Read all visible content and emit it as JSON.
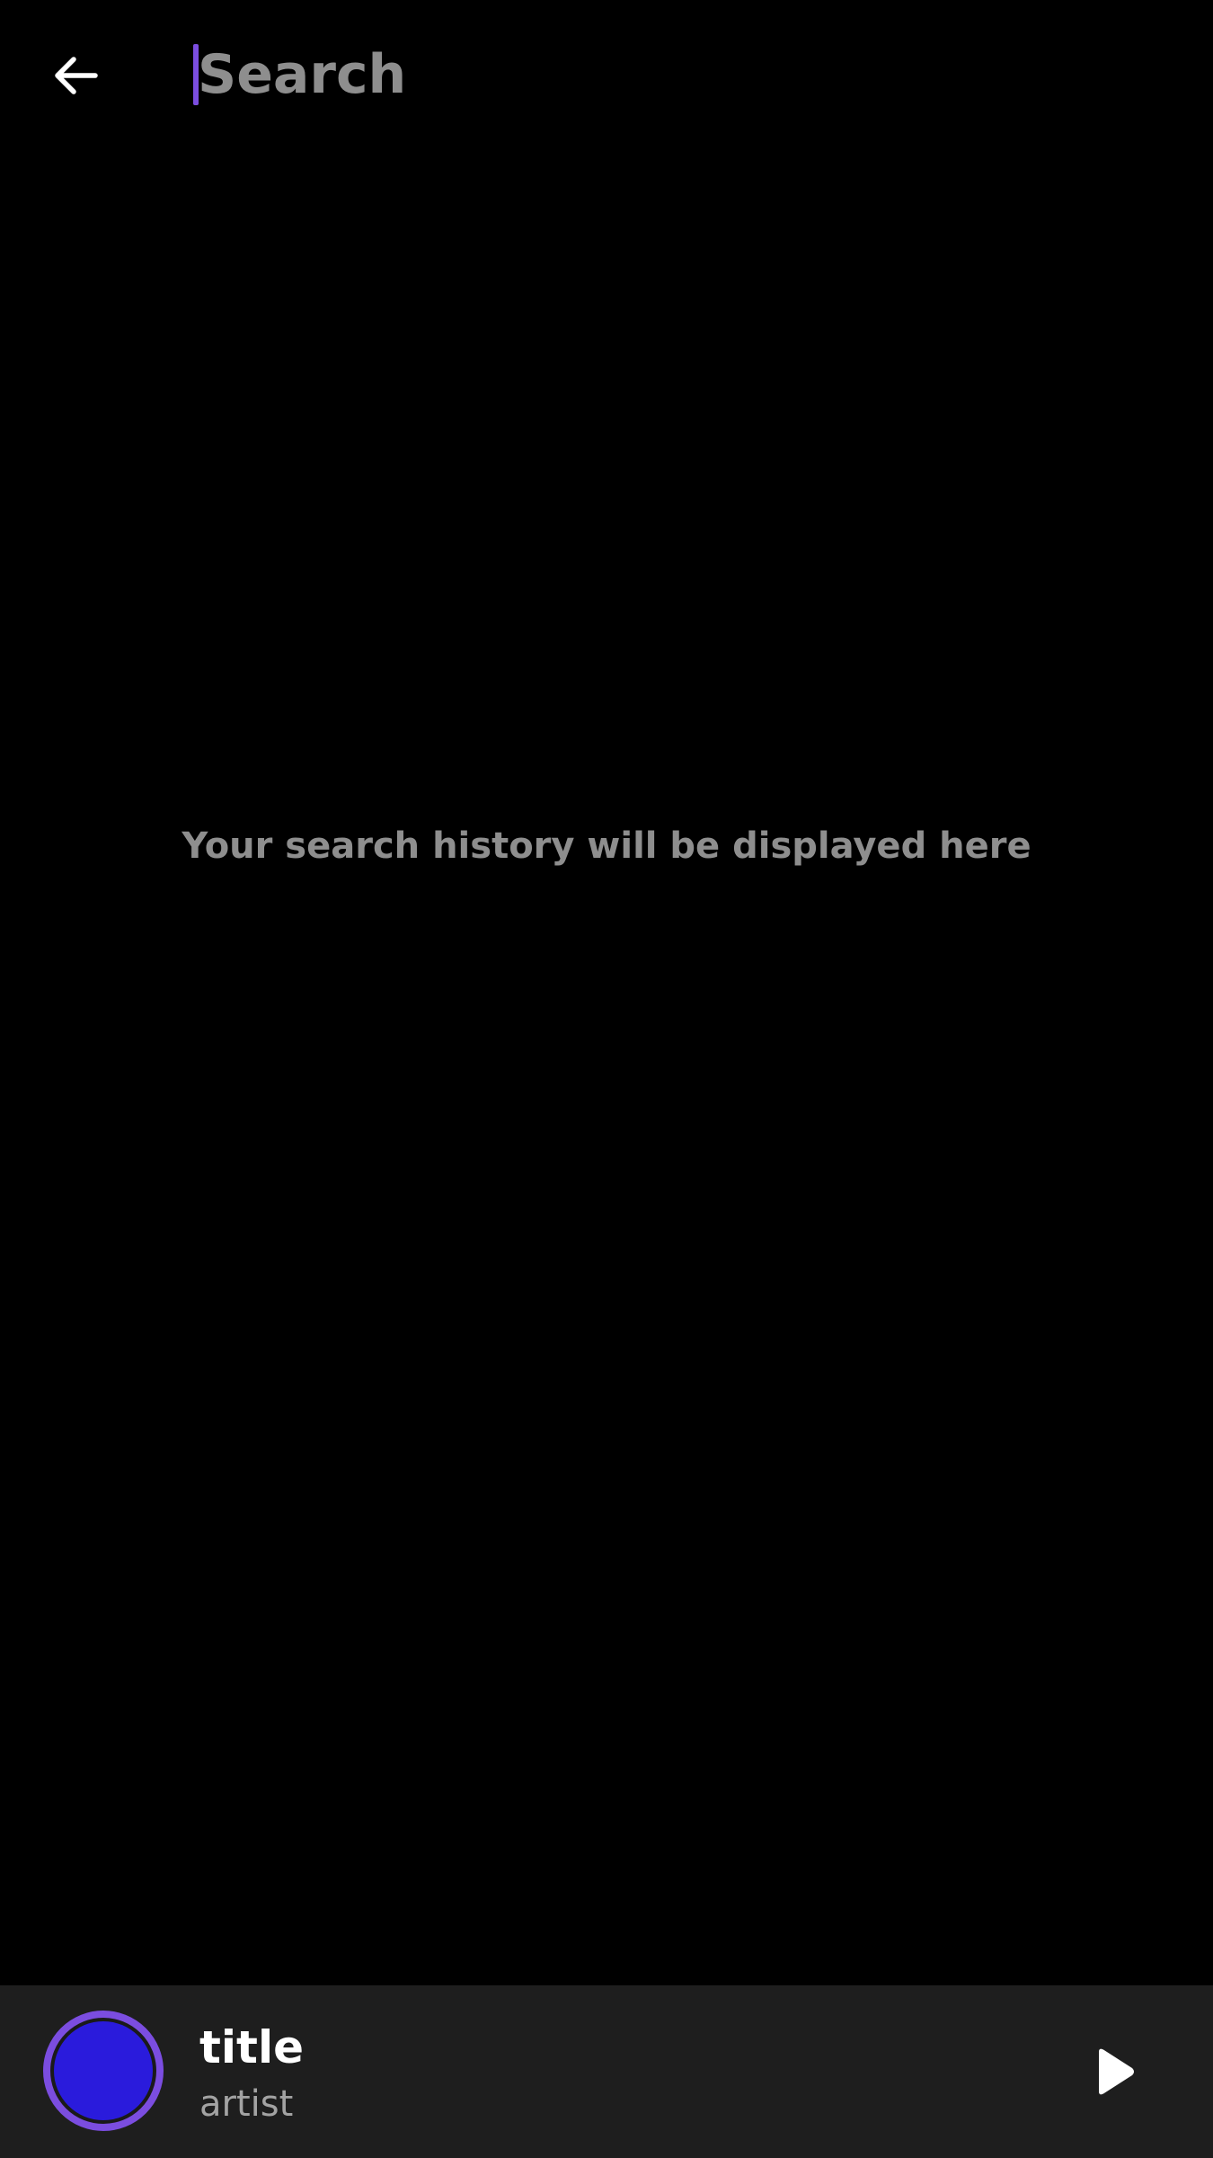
{
  "search": {
    "placeholder": "Search",
    "value": ""
  },
  "empty_state": {
    "message": "Your search history will be displayed here"
  },
  "mini_player": {
    "title": "title",
    "artist": "artist"
  },
  "icons": {
    "back": "arrow-back-icon",
    "play": "play-icon"
  },
  "colors": {
    "background": "#000000",
    "accent": "#7b4de0",
    "cover_fill": "#2a1bdc",
    "player_background": "#1e1e1e",
    "muted_text": "#8e8e8e"
  }
}
